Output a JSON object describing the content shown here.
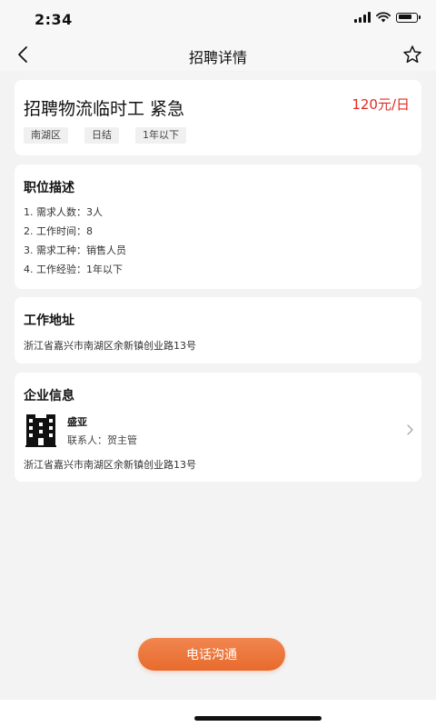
{
  "status_bar": {
    "time": "2:34",
    "battery_level": 0.8
  },
  "nav": {
    "title": "招聘详情",
    "back_icon": "chevron-left-icon",
    "favorite_icon": "star-outline-icon"
  },
  "job": {
    "title": "招聘物流临时工 紧急",
    "salary": "120元/日",
    "tags": [
      "南湖区",
      "日结",
      "1年以下"
    ]
  },
  "description": {
    "heading": "职位描述",
    "items": [
      "1. 需求人数：3人",
      "2. 工作时间：8",
      "3. 需求工种：销售人员",
      "4. 工作经验：1年以下"
    ]
  },
  "work_address": {
    "heading": "工作地址",
    "address": "浙江省嘉兴市南湖区余新镇创业路13号"
  },
  "company": {
    "heading": "企业信息",
    "name": "盛亚",
    "contact": "联系人：贺主管",
    "address": "浙江省嘉兴市南湖区余新镇创业路13号",
    "logo_icon": "building-icon",
    "arrow_icon": "chevron-right-icon"
  },
  "actions": {
    "call_label": "电话沟通"
  },
  "colors": {
    "accent": "#e86a2c",
    "salary": "#e02b20",
    "background": "#f3f3f3"
  }
}
